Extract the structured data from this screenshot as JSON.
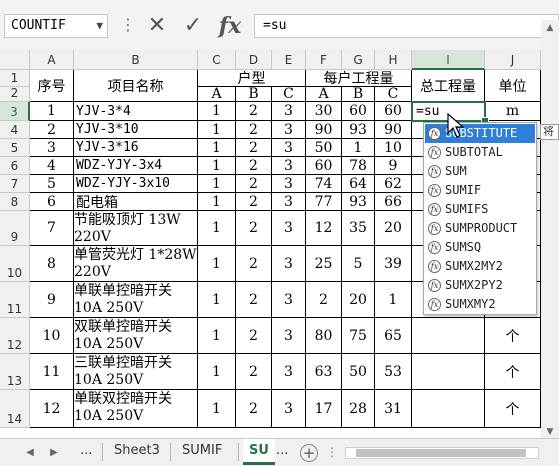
{
  "name_box": "COUNTIF",
  "formula_bar": {
    "separator": "⋮",
    "cancel_icon": "✕",
    "enter_icon": "✓",
    "fx_label": "fx",
    "content": "=su"
  },
  "columns": [
    "A",
    "B",
    "C",
    "D",
    "E",
    "F",
    "G",
    "H",
    "I",
    "J"
  ],
  "rows": [
    "1",
    "2",
    "3",
    "4",
    "5",
    "6",
    "7",
    "8",
    "9",
    "10",
    "11",
    "12",
    "13",
    "14"
  ],
  "header": {
    "seq": "序号",
    "name": "项目名称",
    "house_type": "户型",
    "per_household": "每户工程量",
    "total": "总工程量",
    "unit": "单位",
    "sub": [
      "A",
      "B",
      "C",
      "A",
      "B",
      "C"
    ]
  },
  "items": [
    {
      "seq": "1",
      "name": "YJV-3*4",
      "a": "1",
      "b": "2",
      "c": "3",
      "pa": "30",
      "pb": "60",
      "pc": "60",
      "unit": "m"
    },
    {
      "seq": "2",
      "name": "YJV-3*10",
      "a": "1",
      "b": "2",
      "c": "3",
      "pa": "90",
      "pb": "93",
      "pc": "90",
      "unit": ""
    },
    {
      "seq": "3",
      "name": "YJV-3*16",
      "a": "1",
      "b": "2",
      "c": "3",
      "pa": "50",
      "pb": "1",
      "pc": "10",
      "unit": ""
    },
    {
      "seq": "4",
      "name": "WDZ-YJY-3x4",
      "a": "1",
      "b": "2",
      "c": "3",
      "pa": "60",
      "pb": "78",
      "pc": "9",
      "unit": ""
    },
    {
      "seq": "5",
      "name": "WDZ-YJY-3x10",
      "a": "1",
      "b": "2",
      "c": "3",
      "pa": "74",
      "pb": "64",
      "pc": "62",
      "unit": ""
    },
    {
      "seq": "6",
      "name": "配电箱",
      "a": "1",
      "b": "2",
      "c": "3",
      "pa": "77",
      "pb": "93",
      "pc": "66",
      "unit": ""
    },
    {
      "seq": "7",
      "name": "节能吸顶灯 13W 220V",
      "a": "1",
      "b": "2",
      "c": "3",
      "pa": "12",
      "pb": "35",
      "pc": "20",
      "unit": ""
    },
    {
      "seq": "8",
      "name": "单管荧光灯 1*28W 220V",
      "a": "1",
      "b": "2",
      "c": "3",
      "pa": "25",
      "pb": "5",
      "pc": "39",
      "unit": ""
    },
    {
      "seq": "9",
      "name": "单联单控暗开关 10A 250V",
      "a": "1",
      "b": "2",
      "c": "3",
      "pa": "2",
      "pb": "20",
      "pc": "1",
      "unit": ""
    },
    {
      "seq": "10",
      "name": "双联单控暗开关 10A 250V",
      "a": "1",
      "b": "2",
      "c": "3",
      "pa": "80",
      "pb": "75",
      "pc": "65",
      "unit": "个"
    },
    {
      "seq": "11",
      "name": "三联单控暗开关 10A 250V",
      "a": "1",
      "b": "2",
      "c": "3",
      "pa": "63",
      "pb": "50",
      "pc": "53",
      "unit": "个"
    },
    {
      "seq": "12",
      "name": "单联双控暗开关 10A 250V",
      "a": "1",
      "b": "2",
      "c": "3",
      "pa": "17",
      "pb": "28",
      "pc": "31",
      "unit": "个"
    }
  ],
  "active_cell_text": "=su",
  "autocomplete": [
    "SUBSTITUTE",
    "SUBTOTAL",
    "SUM",
    "SUMIF",
    "SUMIFS",
    "SUMPRODUCT",
    "SUMSQ",
    "SUMX2MY2",
    "SUMX2PY2",
    "SUMXMY2"
  ],
  "tooltip": "将",
  "sheet_tabs": {
    "nav_prev": "◀",
    "nav_next": "▶",
    "ellipsis_left": "...",
    "tabs": [
      "Sheet3",
      "SUMIF",
      "SU"
    ],
    "ellipsis_right": "...",
    "add": "+"
  },
  "colors": {
    "accent": "#217346",
    "highlight": "#2e7fd7"
  }
}
